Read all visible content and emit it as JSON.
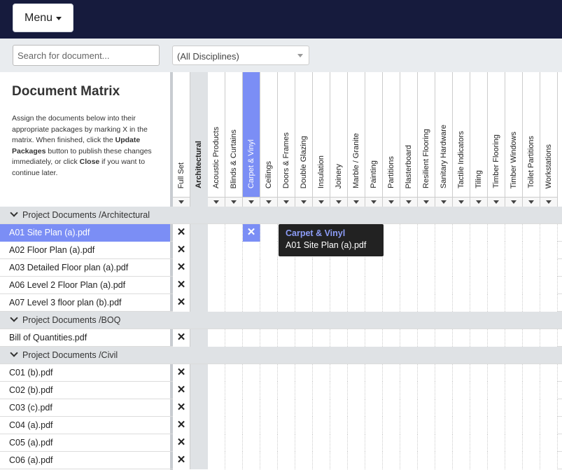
{
  "menu": {
    "label": "Menu"
  },
  "search": {
    "placeholder": "Search for document..."
  },
  "discipline_filter": {
    "selected": "(All Disciplines)"
  },
  "matrix": {
    "title": "Document Matrix",
    "desc": {
      "p1": "Assign the documents below into their appropriate packages by marking X in the matrix. When finished, click the ",
      "b1": "Update Packages",
      "p2": " button to publish these changes immediately, or click ",
      "b2": "Close",
      "p3": " if you want to continue later."
    },
    "columns": [
      "Full Set",
      "Architectural",
      "Acoustic Products",
      "Blinds & Curtains",
      "Carpet & Vinyl",
      "Ceilings",
      "Doors & Frames",
      "Double Glazing",
      "Insulation",
      "Joinery",
      "Marble / Granite",
      "Painting",
      "Partitions",
      "Plasterboard",
      "Resilient Flooring",
      "Sanitary Hardware",
      "Tactile Indicators",
      "Tiling",
      "Timber Flooring",
      "Timber Windows",
      "Toilet Partitions",
      "Workstations"
    ],
    "mark": "✕",
    "groups": [
      {
        "label": "Project Documents /Architectural",
        "docs": [
          "A01 Site Plan (a).pdf",
          "A02 Floor Plan (a).pdf",
          "A03 Detailed Floor plan (a).pdf",
          "A06 Level 2 Floor Plan (a).pdf",
          "A07 Level 3 floor plan (b).pdf"
        ]
      },
      {
        "label": "Project Documents /BOQ",
        "docs": [
          "Bill of Quantities.pdf"
        ]
      },
      {
        "label": "Project Documents /Civil",
        "docs": [
          "C01 (b).pdf",
          "C02 (b).pdf",
          "C03 (c).pdf",
          "C04 (a).pdf",
          "C05 (a).pdf",
          "C06 (a).pdf"
        ]
      }
    ]
  },
  "tooltip": {
    "title": "Carpet & Vinyl",
    "doc": "A01 Site Plan (a).pdf"
  },
  "colors": {
    "topbar": "#161b3d",
    "accent": "#7b8ef5",
    "tooltip_title": "#8c9cf6"
  }
}
